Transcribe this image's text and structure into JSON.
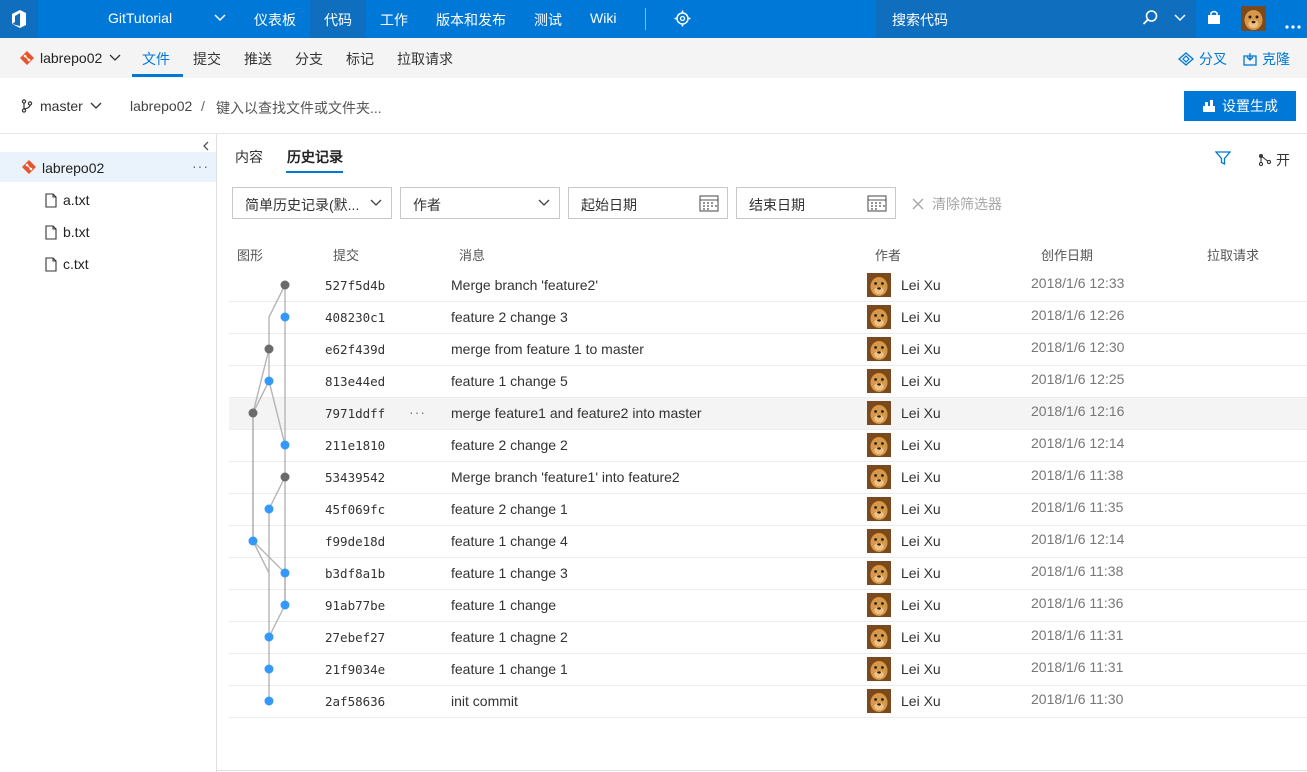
{
  "topbar": {
    "project": "GitTutorial",
    "nav": [
      "仪表板",
      "代码",
      "工作",
      "版本和发布",
      "测试",
      "Wiki"
    ],
    "search_placeholder": "搜索代码"
  },
  "subbar": {
    "repo": "labrepo02",
    "tabs": [
      "文件",
      "提交",
      "推送",
      "分支",
      "标记",
      "拉取请求"
    ],
    "fork_label": "分叉",
    "clone_label": "克隆"
  },
  "pathbar": {
    "branch": "master",
    "repo": "labrepo02",
    "separator": "/",
    "search_placeholder": "键入以查找文件或文件夹...",
    "build_button": "设置生成"
  },
  "tree": {
    "root": "labrepo02",
    "more": "···",
    "files": [
      "a.txt",
      "b.txt",
      "c.txt"
    ]
  },
  "main": {
    "tabs": [
      "内容",
      "历史记录"
    ],
    "open_label": "开",
    "filters": {
      "history_mode": "简单历史记录(默...",
      "author": "作者",
      "start_date": "起始日期",
      "end_date": "结束日期",
      "clear": "清除筛选器"
    },
    "columns": [
      "图形",
      "提交",
      "消息",
      "作者",
      "创作日期",
      "拉取请求"
    ],
    "row_more": "···",
    "commits": [
      {
        "id": "527f5d4b",
        "msg": "Merge branch 'feature2'",
        "author": "Lei Xu",
        "date": "2018/1/6 12:33"
      },
      {
        "id": "408230c1",
        "msg": "feature 2 change 3",
        "author": "Lei Xu",
        "date": "2018/1/6 12:26"
      },
      {
        "id": "e62f439d",
        "msg": "merge from feature 1 to master",
        "author": "Lei Xu",
        "date": "2018/1/6 12:30"
      },
      {
        "id": "813e44ed",
        "msg": "feature 1 change 5",
        "author": "Lei Xu",
        "date": "2018/1/6 12:25"
      },
      {
        "id": "7971ddff",
        "msg": "merge feature1 and feature2 into master",
        "author": "Lei Xu",
        "date": "2018/1/6 12:16"
      },
      {
        "id": "211e1810",
        "msg": "feature 2 change 2",
        "author": "Lei Xu",
        "date": "2018/1/6 12:14"
      },
      {
        "id": "53439542",
        "msg": "Merge branch 'feature1' into feature2",
        "author": "Lei Xu",
        "date": "2018/1/6 11:38"
      },
      {
        "id": "45f069fc",
        "msg": "feature 2 change 1",
        "author": "Lei Xu",
        "date": "2018/1/6 11:35"
      },
      {
        "id": "f99de18d",
        "msg": "feature 1 change 4",
        "author": "Lei Xu",
        "date": "2018/1/6 12:14"
      },
      {
        "id": "b3df8a1b",
        "msg": "feature 1 change 3",
        "author": "Lei Xu",
        "date": "2018/1/6 11:38"
      },
      {
        "id": "91ab77be",
        "msg": "feature 1 change",
        "author": "Lei Xu",
        "date": "2018/1/6 11:36"
      },
      {
        "id": "27ebef27",
        "msg": "feature 1 chagne 2",
        "author": "Lei Xu",
        "date": "2018/1/6 11:31"
      },
      {
        "id": "21f9034e",
        "msg": "feature 1 change 1",
        "author": "Lei Xu",
        "date": "2018/1/6 11:31"
      },
      {
        "id": "2af58636",
        "msg": "init commit",
        "author": "Lei Xu",
        "date": "2018/1/6 11:30"
      }
    ]
  },
  "colors": {
    "accent": "#0078d7",
    "merge_node": "#6b6b6b",
    "commit_node": "#3399ff",
    "git_icon": "#e8552b"
  }
}
